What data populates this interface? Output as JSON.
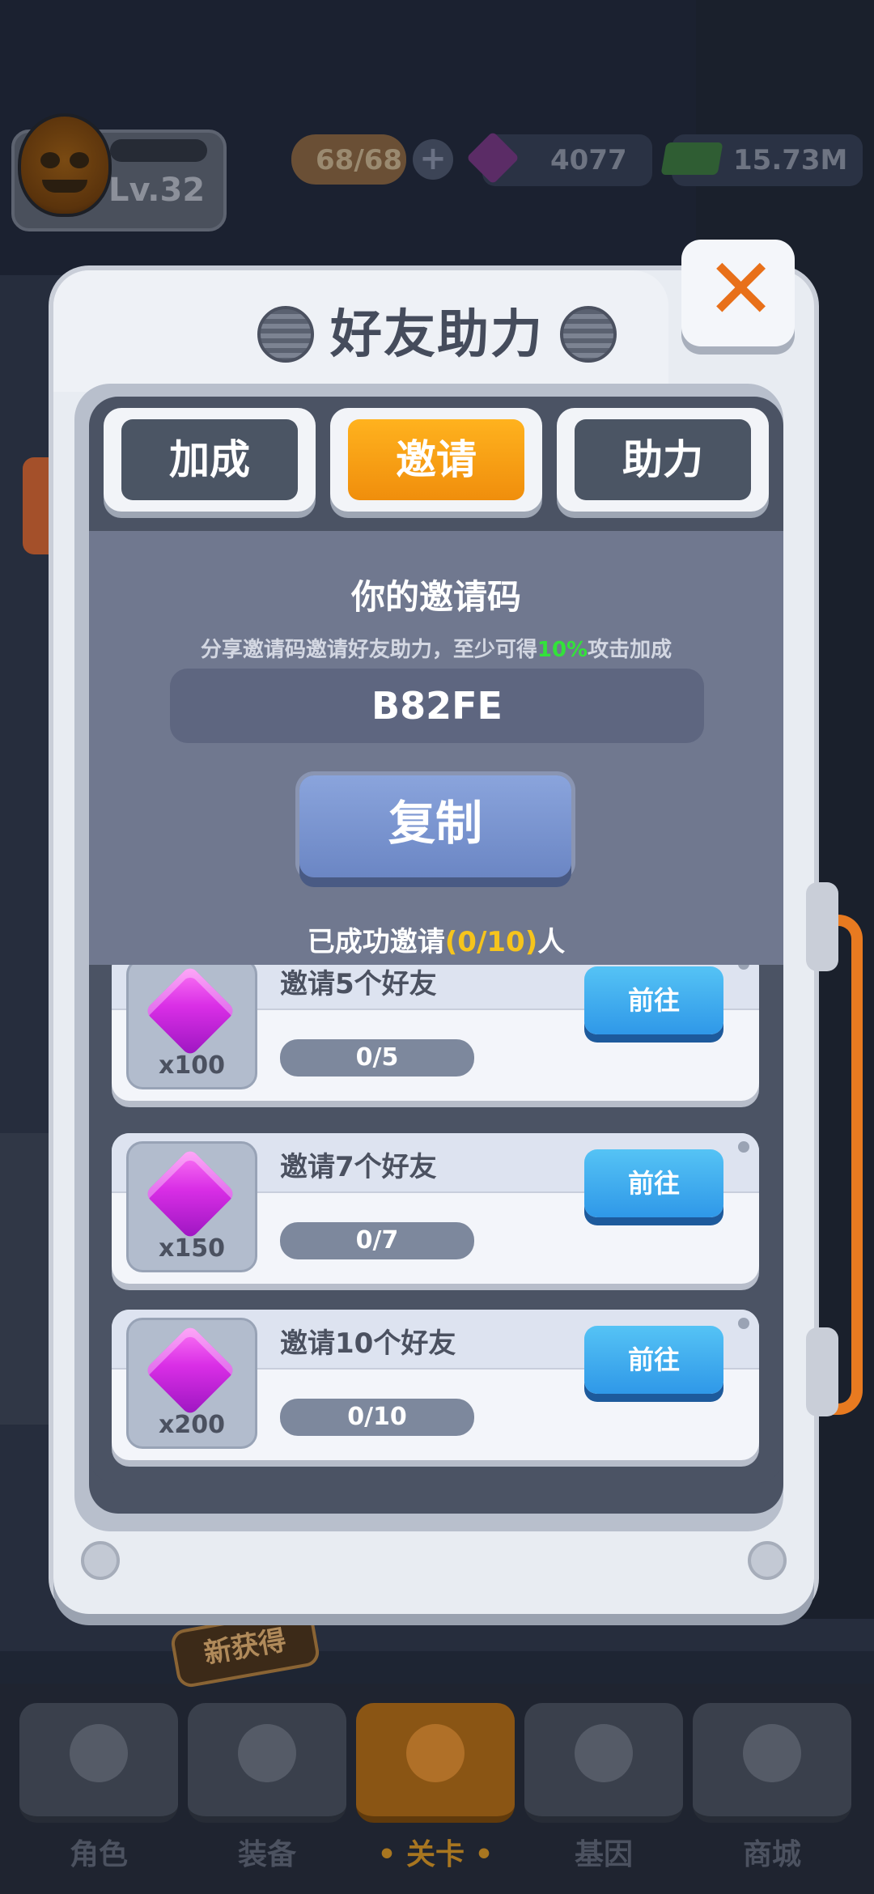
{
  "hud": {
    "level": "Lv.32",
    "energy": "68/68",
    "plus": "+",
    "gems": "4077",
    "cash": "15.73M"
  },
  "modal": {
    "title": "好友助力",
    "close_symbol": "✕",
    "tabs": [
      {
        "label": "加成",
        "active": false
      },
      {
        "label": "邀请",
        "active": true
      },
      {
        "label": "助力",
        "active": false
      }
    ],
    "invite": {
      "title": "你的邀请码",
      "desc_prefix": "分享邀请码邀请好友助力，至少可得",
      "desc_highlight": "10%",
      "desc_suffix": "攻击加成",
      "code": "B82FE",
      "copy_label": "复制",
      "invited_prefix": "已成功邀请",
      "invited_count": "(0/10)",
      "invited_suffix": "人"
    },
    "rewards": [
      {
        "title": "邀请5个好友",
        "qty": "x100",
        "progress": "0/5",
        "button": "前往"
      },
      {
        "title": "邀请7个好友",
        "qty": "x150",
        "progress": "0/7",
        "button": "前往"
      },
      {
        "title": "邀请10个好友",
        "qty": "x200",
        "progress": "0/10",
        "button": "前往"
      }
    ]
  },
  "nav": {
    "badge": "新获得",
    "items": [
      {
        "label": "角色",
        "icon": "skull-icon"
      },
      {
        "label": "装备",
        "icon": "gun-icon"
      },
      {
        "label": "• 关卡 •",
        "icon": "map-pin-icon"
      },
      {
        "label": "基因",
        "icon": "hexagon-icon"
      },
      {
        "label": "商城",
        "icon": "shop-icon"
      }
    ]
  },
  "colors": {
    "accent_orange": "#f59a10",
    "highlight_green": "#33e23a",
    "highlight_yellow": "#f6c41c",
    "go_button_blue": "#2f98e8",
    "gem_purple": "#d92ee6"
  }
}
